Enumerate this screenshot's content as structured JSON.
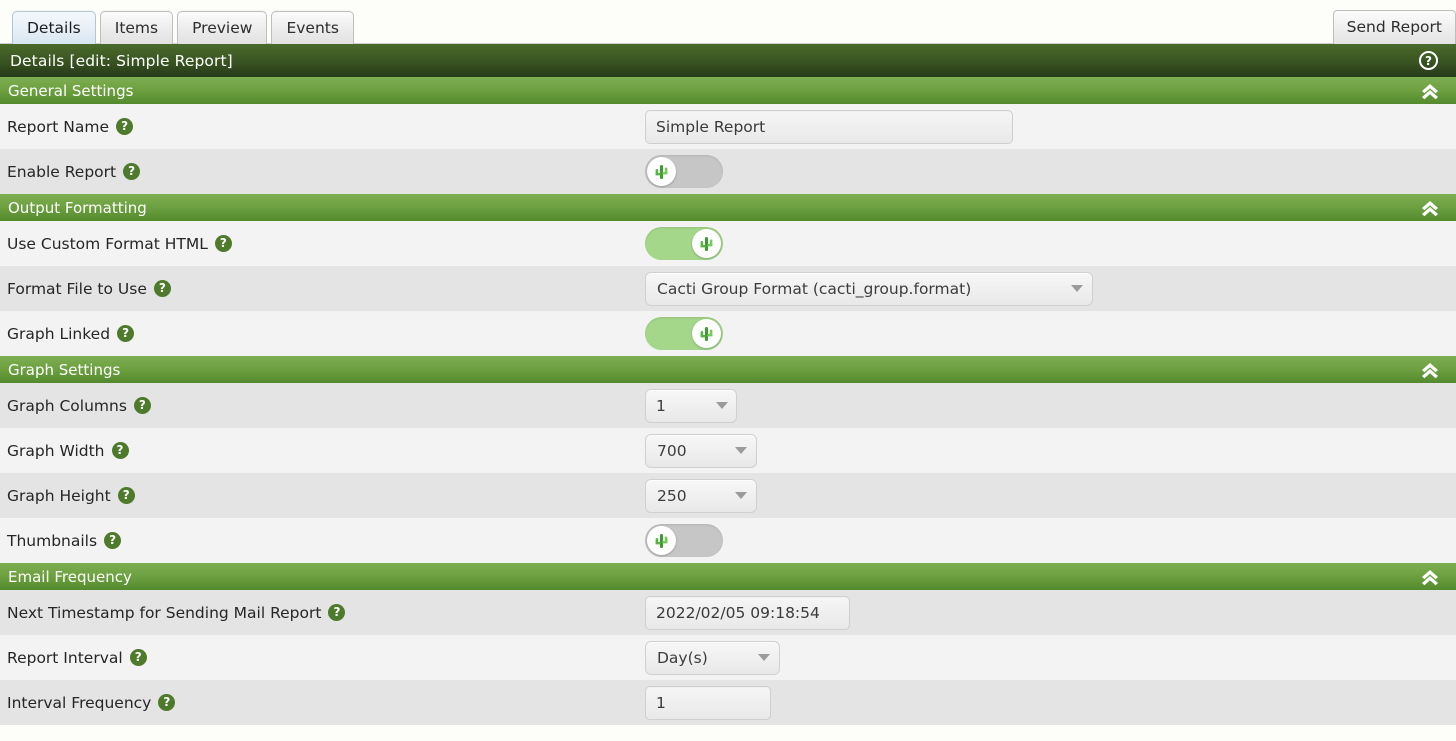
{
  "tabs": [
    {
      "label": "Details",
      "active": true
    },
    {
      "label": "Items",
      "active": false
    },
    {
      "label": "Preview",
      "active": false
    },
    {
      "label": "Events",
      "active": false
    }
  ],
  "toolbar": {
    "send_report_label": "Send Report"
  },
  "page": {
    "title": "Details [edit: Simple Report]",
    "help_glyph": "?"
  },
  "sections": {
    "general": {
      "title": "General Settings",
      "report_name": {
        "label": "Report Name",
        "value": "Simple Report",
        "placeholder": ""
      },
      "enable_report": {
        "label": "Enable Report",
        "state": "off"
      }
    },
    "output": {
      "title": "Output Formatting",
      "use_custom_format_html": {
        "label": "Use Custom Format HTML",
        "state": "on"
      },
      "format_file": {
        "label": "Format File to Use",
        "value": "Cacti Group Format (cacti_group.format)"
      },
      "graph_linked": {
        "label": "Graph Linked",
        "state": "on"
      }
    },
    "graph": {
      "title": "Graph Settings",
      "graph_columns": {
        "label": "Graph Columns",
        "value": "1"
      },
      "graph_width": {
        "label": "Graph Width",
        "value": "700"
      },
      "graph_height": {
        "label": "Graph Height",
        "value": "250"
      },
      "thumbnails": {
        "label": "Thumbnails",
        "state": "off"
      }
    },
    "email": {
      "title": "Email Frequency",
      "next_timestamp": {
        "label": "Next Timestamp for Sending Mail Report",
        "value": "2022/02/05 09:18:54"
      },
      "report_interval": {
        "label": "Report Interval",
        "value": "Day(s)"
      },
      "interval_frequency": {
        "label": "Interval Frequency",
        "value": "1"
      }
    }
  },
  "colors": {
    "title_bar_dark_green": "#395321",
    "section_header_green": "#6ca03f",
    "help_badge_green": "#4e7a2b",
    "toggle_on_green": "#a5d78b",
    "toggle_off_gray": "#c6c6c6",
    "row_light": "#f3f3f3",
    "row_alt": "#e4e4e4",
    "active_tab_blue": "#d6e6f2"
  }
}
